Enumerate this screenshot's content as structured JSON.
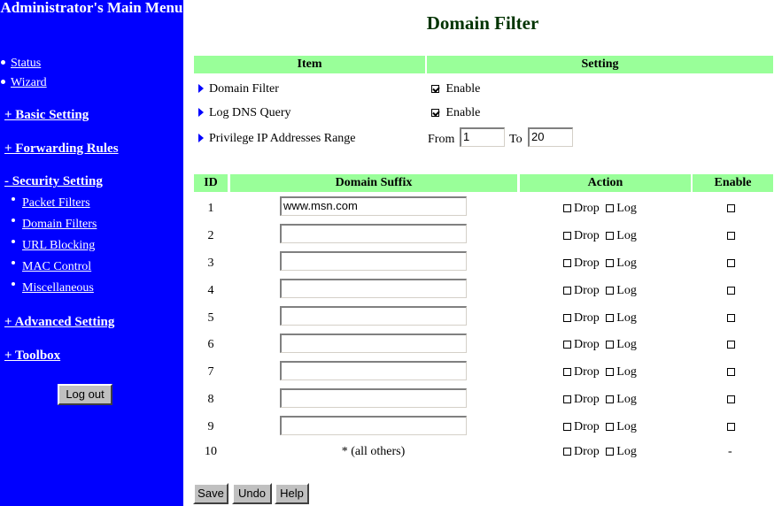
{
  "sidebar": {
    "title": "Administrator's Main Menu",
    "top_links": [
      "Status",
      "Wizard"
    ],
    "sections": [
      "+ Basic Setting",
      "+ Forwarding Rules",
      "- Security Setting",
      "+ Advanced Setting",
      "+ Toolbox"
    ],
    "security_items": [
      "Packet Filters",
      "Domain Filters",
      "URL Blocking",
      "MAC Control",
      "Miscellaneous"
    ],
    "logout_label": "Log out"
  },
  "page": {
    "title": "Domain Filter"
  },
  "settings": {
    "header_item": "Item",
    "header_setting": "Setting",
    "rows": [
      {
        "label": "Domain Filter",
        "value_label": "Enable",
        "checked": true
      },
      {
        "label": "Log DNS Query",
        "value_label": "Enable",
        "checked": true
      }
    ],
    "privilege": {
      "label": "Privilege IP Addresses Range",
      "from_label": "From",
      "from_value": "1",
      "to_label": "To",
      "to_value": "20"
    }
  },
  "table": {
    "headers": [
      "ID",
      "Domain Suffix",
      "Action",
      "Enable"
    ],
    "drop_label": "Drop",
    "log_label": "Log",
    "rows": [
      {
        "id": "1",
        "suffix": "www.msn.com"
      },
      {
        "id": "2",
        "suffix": ""
      },
      {
        "id": "3",
        "suffix": ""
      },
      {
        "id": "4",
        "suffix": ""
      },
      {
        "id": "5",
        "suffix": ""
      },
      {
        "id": "6",
        "suffix": ""
      },
      {
        "id": "7",
        "suffix": ""
      },
      {
        "id": "8",
        "suffix": ""
      },
      {
        "id": "9",
        "suffix": ""
      }
    ],
    "last_row": {
      "id": "10",
      "suffix_text": "* (all others)",
      "enable_text": "-"
    }
  },
  "buttons": {
    "save": "Save",
    "undo": "Undo",
    "help": "Help"
  },
  "colors": {
    "sidebar_bg": "#0000ff",
    "header_bg": "#99ff99",
    "title_color": "#003300"
  }
}
